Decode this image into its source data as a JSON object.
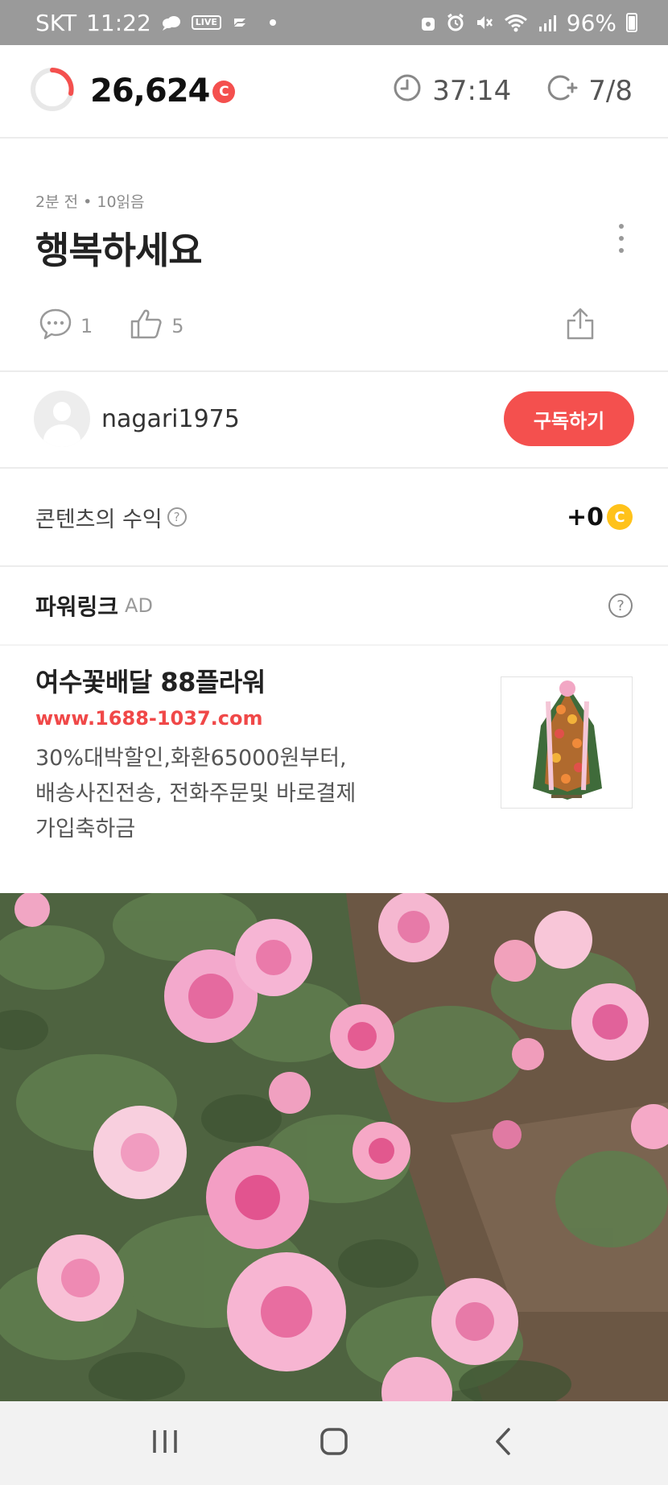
{
  "status_bar": {
    "carrier": "SKT",
    "time": "11:22",
    "live_badge": "LIVE",
    "battery_text": "96%"
  },
  "topbar": {
    "points": "26,624",
    "coin_letter": "C",
    "timer": "37:14",
    "counter": "7/8"
  },
  "post": {
    "meta": "2분 전 • 10읽음",
    "title": "행복하세요",
    "comment_count": "1",
    "like_count": "5"
  },
  "author": {
    "name": "nagari1975",
    "subscribe_label": "구독하기"
  },
  "earnings": {
    "label": "콘텐츠의 수익",
    "help": "?",
    "value": "+0",
    "coin_letter": "C"
  },
  "powerlink": {
    "title": "파워링크",
    "ad_tag": "AD",
    "help": "?",
    "ad": {
      "title": "여수꽃배달 88플라워",
      "url": "www.1688-1037.com",
      "desc_line1": "30%대박할인,화환65000원부터,",
      "desc_line2": "배송사진전송, 전화주문및 바로결제",
      "desc_line3": "가입축하금"
    }
  },
  "colors": {
    "accent": "#f4504e",
    "coin_yellow": "#ffc21a",
    "url_red": "#f04848",
    "status_bar": "#9a9a9a"
  },
  "icons": [
    "progress-ring-icon",
    "clock-icon",
    "coin-plus-icon",
    "comment-icon",
    "thumb-up-icon",
    "share-icon",
    "more-vert-icon",
    "help-icon",
    "recent-apps-icon",
    "home-icon",
    "back-icon"
  ]
}
